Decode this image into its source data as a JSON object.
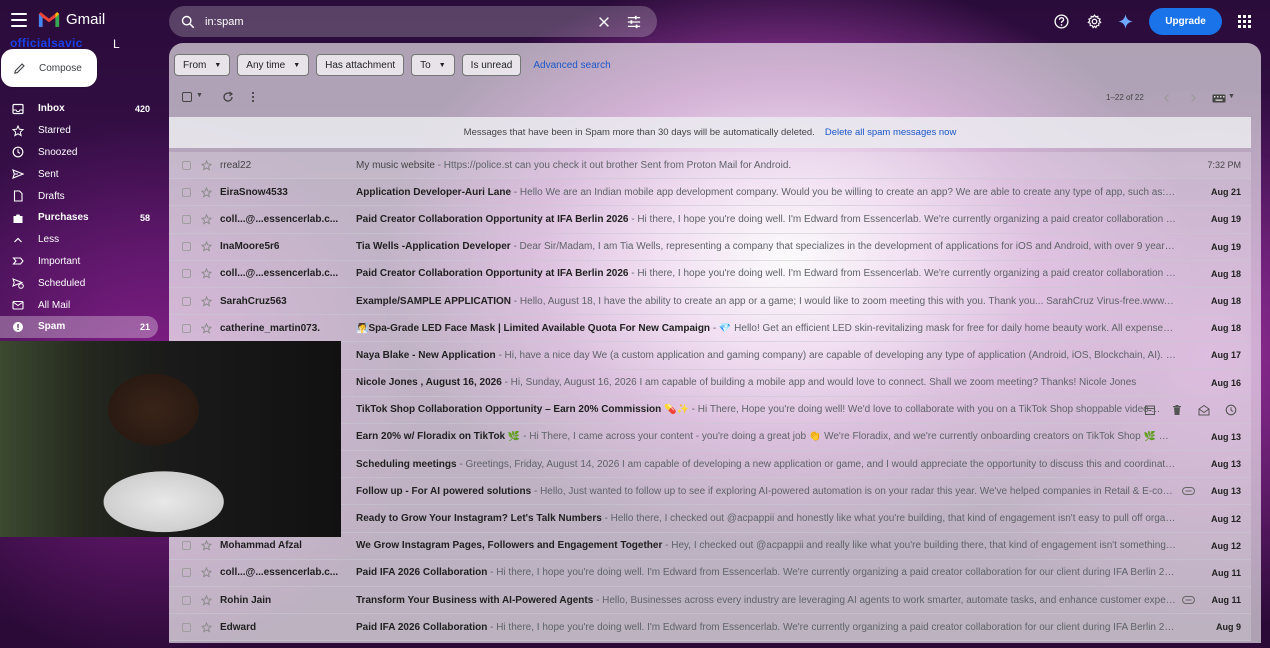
{
  "app": {
    "logo_text": "Gmail"
  },
  "search": {
    "value": "in:spam"
  },
  "header": {
    "upgrade_label": "Upgrade"
  },
  "account": {
    "name": "officialsavic",
    "extra": "L"
  },
  "compose": {
    "label": "Compose"
  },
  "sidebar": {
    "items": [
      {
        "label": "Inbox",
        "count": "420",
        "icon": "inbox-icon",
        "bold": true
      },
      {
        "label": "Starred",
        "count": "",
        "icon": "star-icon"
      },
      {
        "label": "Snoozed",
        "count": "",
        "icon": "clock-icon"
      },
      {
        "label": "Sent",
        "count": "",
        "icon": "send-icon"
      },
      {
        "label": "Drafts",
        "count": "",
        "icon": "draft-icon"
      },
      {
        "label": "Purchases",
        "count": "58",
        "icon": "tag-icon",
        "bold": true
      },
      {
        "label": "Less",
        "count": "",
        "icon": "chevron-up-icon"
      },
      {
        "label": "Important",
        "count": "",
        "icon": "important-icon"
      },
      {
        "label": "Scheduled",
        "count": "",
        "icon": "scheduled-icon"
      },
      {
        "label": "All Mail",
        "count": "",
        "icon": "all-mail-icon"
      },
      {
        "label": "Spam",
        "count": "21",
        "icon": "spam-icon",
        "active": true
      }
    ]
  },
  "filters": {
    "from": "From",
    "any_time": "Any time",
    "has_attachment": "Has attachment",
    "to": "To",
    "is_unread": "Is unread",
    "advanced": "Advanced search"
  },
  "toolbar": {
    "pager": "1–22 of 22"
  },
  "notice": {
    "text": "Messages that have been in Spam more than 30 days will be automatically deleted.",
    "link": "Delete all spam messages now"
  },
  "emails": [
    {
      "sender": "rreal22",
      "subject": "My music website",
      "snippet": " - Https://police.st can you check it out brother Sent from Proton Mail for Android.",
      "date": "7:32 PM",
      "read": true
    },
    {
      "sender": "EiraSnow4533",
      "subject": "Application Developer-Auri Lane",
      "snippet": " - Hello We are an Indian mobile app development company. Would you be willing to create an app? We are able to create any type of app, such as: 1) The ...",
      "date": "Aug 21"
    },
    {
      "sender": "coll...@...essencerlab.c...",
      "subject": "Paid Creator Collaboration Opportunity at IFA Berlin 2026",
      "snippet": " - Hi there, I hope you're doing well. I'm Edward from Essencerlab. We're currently organizing a paid creator collaboration for o...",
      "date": "Aug 19"
    },
    {
      "sender": "InaMoore5r6",
      "subject": "Tia Wells -Application Developer",
      "snippet": " - Dear Sir/Madam, I am Tia Wells, representing a company that specializes in the development of applications for iOS and Android, with over 9 years of ex...",
      "date": "Aug 19"
    },
    {
      "sender": "coll...@...essencerlab.c...",
      "subject": "Paid Creator Collaboration Opportunity at IFA Berlin 2026",
      "snippet": " - Hi there, I hope you're doing well. I'm Edward from Essencerlab. We're currently organizing a paid creator collaboration for o...",
      "date": "Aug 18"
    },
    {
      "sender": "SarahCruz563",
      "subject": "Example/SAMPLE APPLICATION",
      "snippet": " - Hello, August 18, I have the ability to create an app or a game; I would like to zoom meeting this with you. Thank you... SarahCruz Virus-free.www.avast.c...",
      "date": "Aug 18"
    },
    {
      "sender": "catherine_martin073.",
      "subject": "🧖Spa-Grade LED Face Mask | Limited Available Quota For New Campaign",
      "snippet": " - 💎 Hello! Get an efficient LED skin-revitalizing mask for free for daily home beauty work. All expenses pre-s...",
      "date": "Aug 18"
    },
    {
      "sender": "",
      "subject": "Naya Blake - New Application",
      "snippet": " - Hi, have a nice day We (a custom application and gaming company) are capable of developing any type of application (Android, iOS, Blockchain, AI). Would...",
      "date": "Aug 17"
    },
    {
      "sender": "",
      "subject": "Nicole Jones , August 16, 2026",
      "snippet": " - Hi, Sunday, August 16, 2026 I am capable of building a mobile app and would love to connect. Shall we zoom meeting? Thanks! Nicole Jones",
      "date": "Aug 16"
    },
    {
      "sender": "",
      "subject": "TikTok Shop Collaboration Opportunity – Earn 20% Commission 💊✨",
      "snippet": " - Hi There, Hope you're doing well! We'd love to collaborate with you on a TikTok Shop shoppable video ...",
      "date": "",
      "hover": true
    },
    {
      "sender": "",
      "subject": "Earn 20% w/ Floradix on TikTok 🌿",
      "snippet": " - Hi There, I came across your content - you're doing a great job 👏 We're Floradix, and we're currently onboarding creators on TikTok Shop 🌿 💸 20% ...",
      "date": "Aug 13"
    },
    {
      "sender": "",
      "subject": "Scheduling meetings",
      "snippet": " - Greetings, Friday, August 14, 2026 I am capable of developing a new application or game, and I would appreciate the opportunity to discuss this and coordinate a",
      "date": "Aug 13"
    },
    {
      "sender": "",
      "subject": "Follow up - For AI powered solutions",
      "snippet": " - Hello, Just wanted to follow up to see if exploring AI-powered automation is on your radar this year. We've helped companies in Retail & E-commerc...",
      "date": "Aug 13",
      "chip": true
    },
    {
      "sender": "",
      "subject": "Ready to Grow Your Instagram? Let's Talk Numbers",
      "snippet": " - Hello there, I checked out @acpappii and honestly like what you're building, that kind of engagement isn't easy to pull off organically...",
      "date": "Aug 12"
    },
    {
      "sender": "Mohammad Afzal",
      "subject": "We Grow Instagram Pages, Followers and Engagement Together",
      "snippet": " - Hey, I checked out @acpappii and really like what you're building there, that kind of engagement isn't something that ...",
      "date": "Aug 12"
    },
    {
      "sender": "coll...@...essencerlab.c...",
      "subject": "Paid IFA 2026 Collaboration",
      "snippet": " - Hi there, I hope you're doing well. I'm Edward from Essencerlab. We're currently organizing a paid creator collaboration for our client during IFA Berlin 2026,",
      "date": "Aug 11"
    },
    {
      "sender": "Rohin Jain",
      "subject": "Transform Your Business with AI-Powered Agents",
      "snippet": " - Hello, Businesses across every industry are leveraging AI agents to work smarter, automate tasks, and enhance customer experiences...",
      "date": "Aug 11",
      "chip": true
    },
    {
      "sender": "Edward",
      "subject": "Paid IFA 2026 Collaboration",
      "snippet": " - Hi there, I hope you're doing well. I'm Edward from Essencerlab. We're currently organizing a paid creator collaboration for our client during IFA Berlin 2026,",
      "date": "Aug 9"
    }
  ]
}
